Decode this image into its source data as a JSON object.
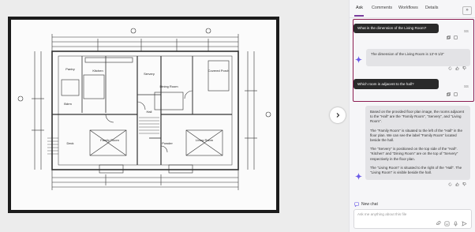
{
  "viewer": {
    "rooms": {
      "dining": "Dining Room",
      "kitchen": "Kitchen",
      "family": "Family Room",
      "living": "Living Room",
      "hall": "Hall",
      "covered_porch": "Covered Porch",
      "servery": "Servery",
      "pantry": "Pantry",
      "deck": "Deck",
      "bdrm": "Bdrm",
      "powder": "Powder"
    }
  },
  "panel": {
    "tabs": [
      "Ask",
      "Comments",
      "Workflows",
      "Details"
    ],
    "active_tab": "Ask",
    "collapse_label": "»"
  },
  "chat": {
    "q1": "What is the dimension of the Living Room?",
    "a1": "The dimension of the Living Room is 13'-9 1/2\"",
    "q2": "Which room is adjacent to the hall?",
    "a2": [
      "Based on the provided floor plan image, the rooms adjacent to the \"Hall\" are the \"Family Room\", \"Servery\", and \"Living Room\".",
      "The \"Family Room\" is situated to the left of the \"Hall\" in the floor plan. We can see the label \"Family Room\" located beside the hall.",
      "The \"Servery\" is positioned on the top side of the \"Hall\". \"Kitchen\" and \"Dining Room\" are on the top of \"Servery\" respectively in the floor plan.",
      "The \"Living Room\" is situated to the right of the \"Hall\". The \"Living Room\" is visible beside the hall."
    ],
    "user_badge": "SS"
  },
  "composer": {
    "new_chat_label": "New chat",
    "placeholder": "Ask me anything about this file"
  }
}
